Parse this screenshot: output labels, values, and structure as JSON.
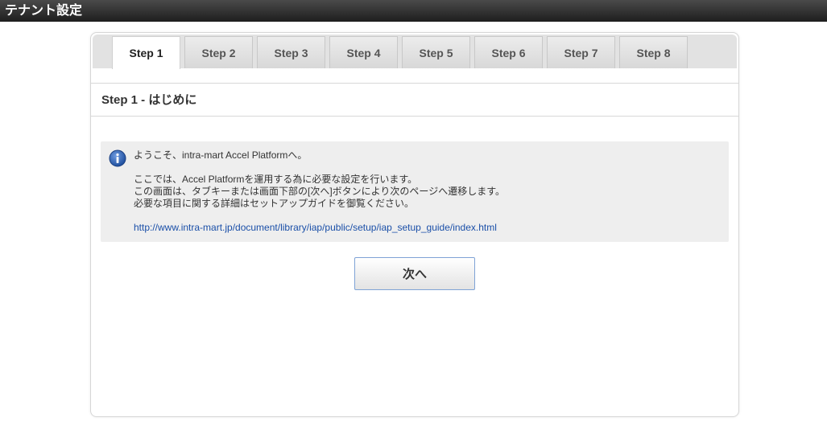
{
  "header": {
    "title": "テナント設定"
  },
  "tabs": [
    {
      "label": "Step 1",
      "active": true
    },
    {
      "label": "Step 2",
      "active": false
    },
    {
      "label": "Step 3",
      "active": false
    },
    {
      "label": "Step 4",
      "active": false
    },
    {
      "label": "Step 5",
      "active": false
    },
    {
      "label": "Step 6",
      "active": false
    },
    {
      "label": "Step 7",
      "active": false
    },
    {
      "label": "Step 8",
      "active": false
    }
  ],
  "section": {
    "title": "Step 1 - はじめに"
  },
  "info": {
    "icon": "info-icon",
    "line1": "ようこそ、intra-mart Accel Platformへ。",
    "line2": "ここでは、Accel Platformを運用する為に必要な設定を行います。",
    "line3": "この画面は、タブキーまたは画面下部の[次へ]ボタンにより次のページへ遷移します。",
    "line4": "必要な項目に関する詳細はセットアップガイドを御覧ください。",
    "link": "http://www.intra-mart.jp/document/library/iap/public/setup/iap_setup_guide/index.html"
  },
  "actions": {
    "next_label": "次へ"
  },
  "colors": {
    "header_bg": "#2a2a2a",
    "info_bg": "#eeeeee",
    "link": "#1a4fa8",
    "button_border": "#7fa3d6",
    "icon_blue": "#2c5fb0"
  }
}
